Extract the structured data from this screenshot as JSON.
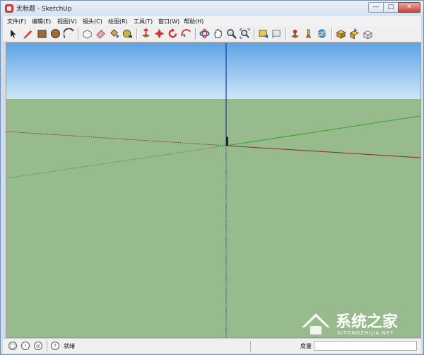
{
  "window": {
    "title": "无标题 - SketchUp",
    "buttons": {
      "minimize": "—",
      "maximize": "□",
      "close": "✕"
    }
  },
  "menu": [
    {
      "id": "file",
      "label": "文件(F)"
    },
    {
      "id": "edit",
      "label": "编辑(E)"
    },
    {
      "id": "view",
      "label": "视图(V)"
    },
    {
      "id": "camera",
      "label": "镜头(C)"
    },
    {
      "id": "draw",
      "label": "绘图(R)"
    },
    {
      "id": "tools",
      "label": "工具(T)"
    },
    {
      "id": "window",
      "label": "窗口(W)"
    },
    {
      "id": "help",
      "label": "帮助(H)"
    }
  ],
  "toolbar": [
    {
      "name": "select-tool-icon"
    },
    {
      "name": "pencil-line-tool-icon"
    },
    {
      "name": "rectangle-tool-icon"
    },
    {
      "name": "circle-tool-icon"
    },
    {
      "name": "arc-tool-icon"
    },
    {
      "name": "make-component-icon"
    },
    {
      "name": "eraser-tool-icon"
    },
    {
      "name": "paint-bucket-icon"
    },
    {
      "name": "tape-measure-icon"
    },
    {
      "name": "push-pull-tool-icon"
    },
    {
      "name": "move-tool-icon"
    },
    {
      "name": "rotate-tool-icon"
    },
    {
      "name": "follow-me-tool-icon"
    },
    {
      "name": "orbit-tool-icon"
    },
    {
      "name": "pan-tool-icon"
    },
    {
      "name": "zoom-tool-icon"
    },
    {
      "name": "zoom-extents-icon"
    },
    {
      "name": "previous-view-icon"
    },
    {
      "name": "next-view-icon"
    },
    {
      "name": "position-camera-icon"
    },
    {
      "name": "walk-tool-icon"
    },
    {
      "name": "look-around-icon"
    },
    {
      "name": "get-models-icon"
    },
    {
      "name": "share-model-icon"
    },
    {
      "name": "share-component-icon"
    }
  ],
  "colors": {
    "sky_top": "#5ea4e6",
    "sky_bottom": "#cfe6f8",
    "ground": "#98bb8d",
    "axis_red": "#8a2a1e",
    "axis_green": "#2ca52c",
    "axis_blue": "#2233aa"
  },
  "statusbar": {
    "status_text": "就绪",
    "measure_label": "度量",
    "icons": [
      "geo-location-icon",
      "credits-icon",
      "user-icon",
      "help-icon"
    ],
    "help_glyph": "?"
  },
  "watermark": {
    "text": "系统之家",
    "url": "XITONGZHIJIA.NET"
  }
}
